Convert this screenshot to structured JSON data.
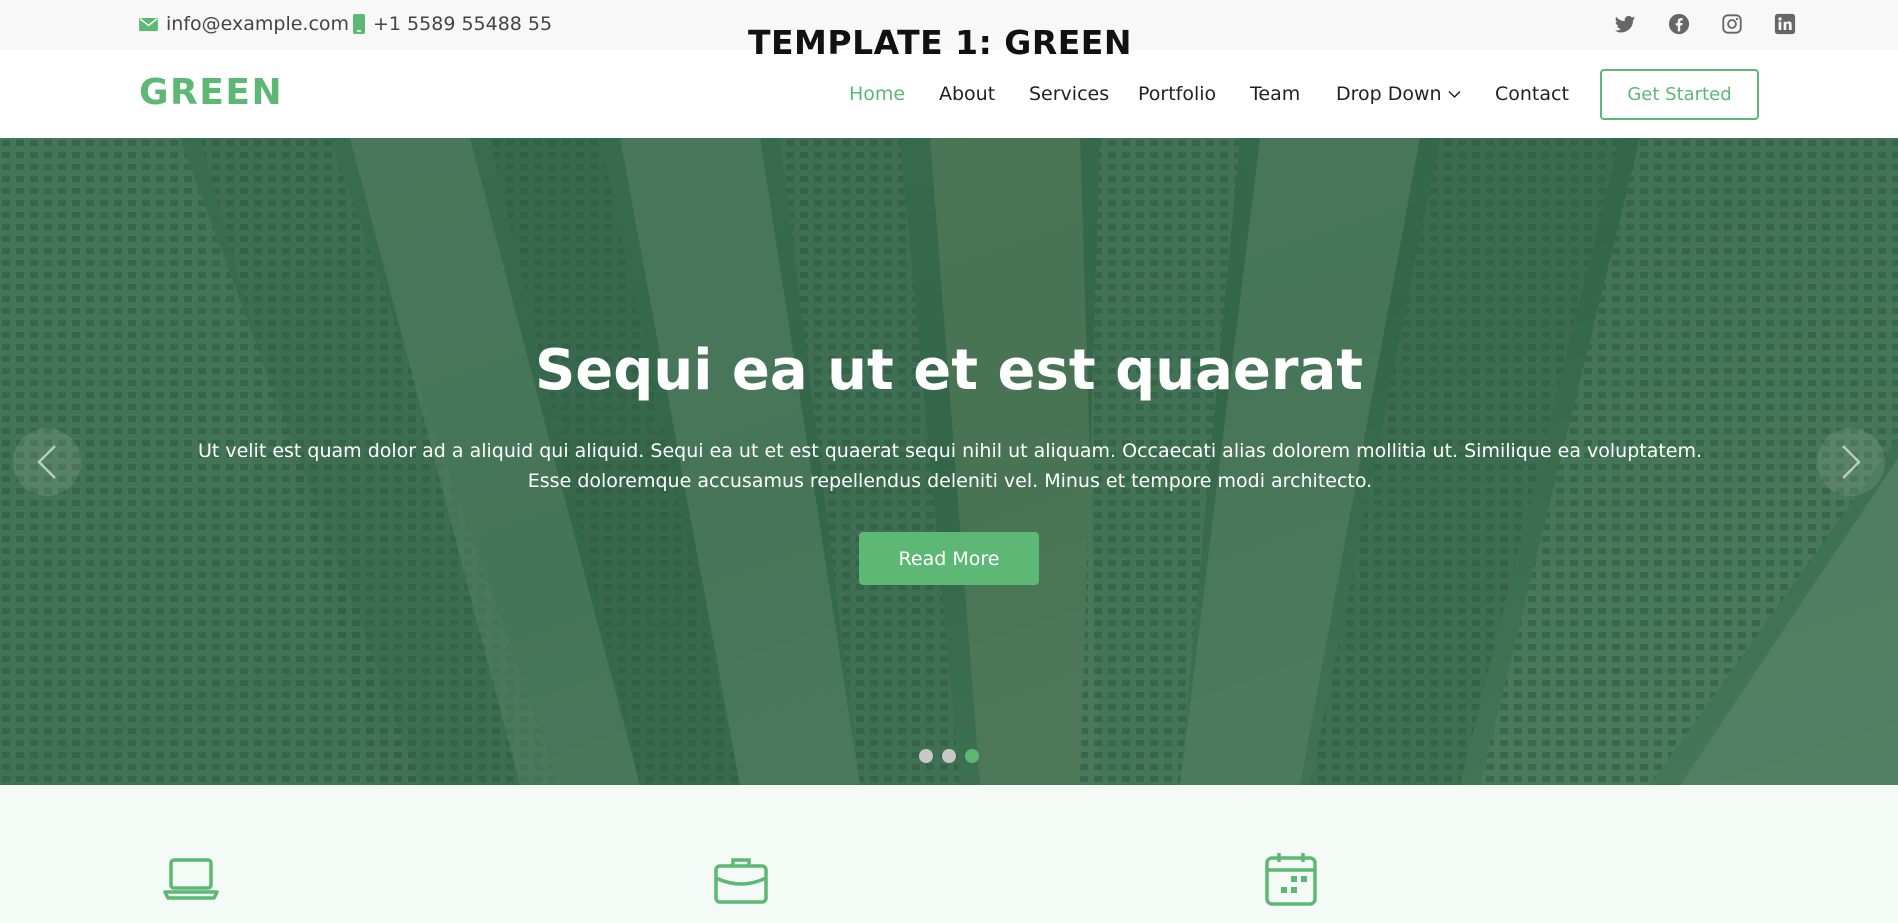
{
  "template_title": "TEMPLATE 1: GREEN",
  "topbar": {
    "email": "info@example.com",
    "phone": "+1 5589 55488 55",
    "socials": [
      "twitter-icon",
      "facebook-icon",
      "instagram-icon",
      "linkedin-icon"
    ]
  },
  "navbar": {
    "logo": "GREEN",
    "items": [
      {
        "label": "Home",
        "active": true
      },
      {
        "label": "About"
      },
      {
        "label": "Services"
      },
      {
        "label": "Portfolio"
      },
      {
        "label": "Team"
      },
      {
        "label": "Drop Down",
        "dropdown": true
      },
      {
        "label": "Contact"
      }
    ],
    "cta": "Get Started"
  },
  "hero": {
    "title": "Sequi ea ut et est quaerat",
    "text": "Ut velit est quam dolor ad a aliquid qui aliquid. Sequi ea ut et est quaerat sequi nihil ut aliquam. Occaecati alias dolorem mollitia ut. Similique ea voluptatem. Esse doloremque accusamus repellendus deleniti vel. Minus et tempore modi architecto.",
    "button": "Read More",
    "slides": 3,
    "active_slide": 3
  },
  "features": {
    "icons": [
      "laptop-icon",
      "briefcase-icon",
      "calendar-icon"
    ]
  },
  "colors": {
    "accent": "#5cb874",
    "hero_overlay": "#2c6e48",
    "topbar_bg": "#f8f8f8",
    "features_bg": "#f4faf6"
  }
}
